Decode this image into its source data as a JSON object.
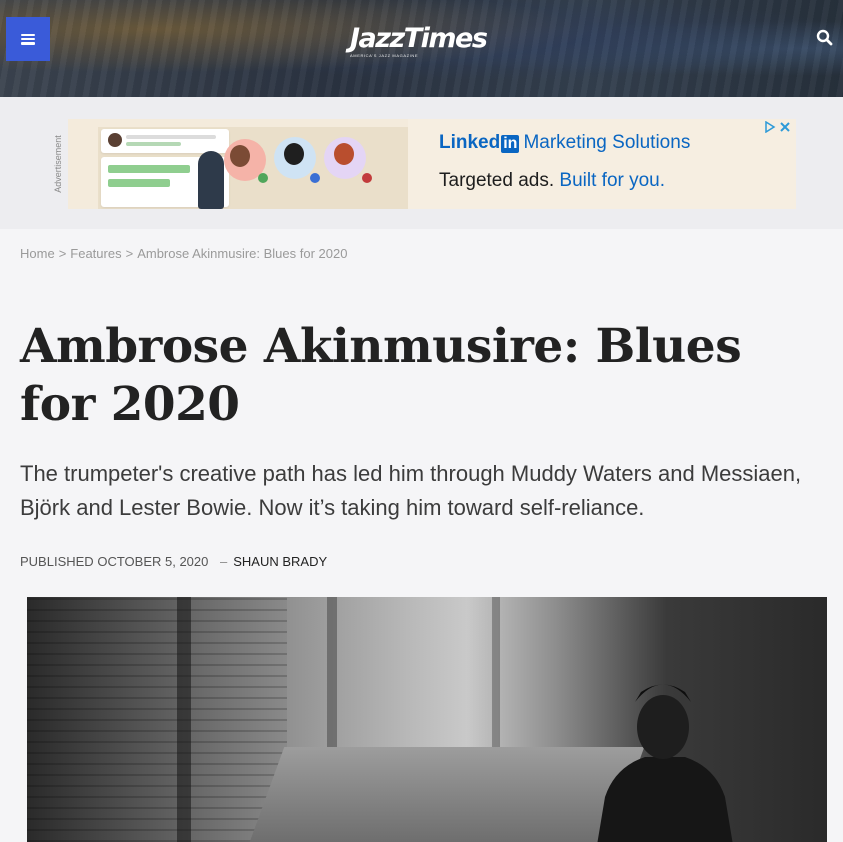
{
  "header": {
    "logo": "JazzTimes",
    "logo_tagline": "AMERICA'S JAZZ MAGAZINE",
    "menu_icon": "hamburger-icon",
    "search_icon": "search-icon"
  },
  "ad": {
    "side_label": "Advertisement",
    "brand_prefix": "Linked",
    "brand_in": "in",
    "brand_suffix": "Marketing Solutions",
    "tag_plain": "Targeted ads.",
    "tag_accent": "Built for you.",
    "accent_color": "#0a66c2"
  },
  "breadcrumb": {
    "home": "Home",
    "section": "Features",
    "current": "Ambrose Akinmusire: Blues for 2020",
    "separator": ">"
  },
  "article": {
    "title": "Ambrose Akinmusire: Blues for 2020",
    "dek": "The trumpeter's creative path has led him through Muddy Waters and Messiaen, Björk and Lester Bowie. Now it’s taking him toward self-reliance.",
    "published_label": "PUBLISHED",
    "published_date": "OCTOBER 5, 2020",
    "byline_dash": "–",
    "author": "SHAUN BRADY"
  },
  "colors": {
    "menu_button": "#3a5bd9",
    "page_bg": "#f5f5f7"
  }
}
